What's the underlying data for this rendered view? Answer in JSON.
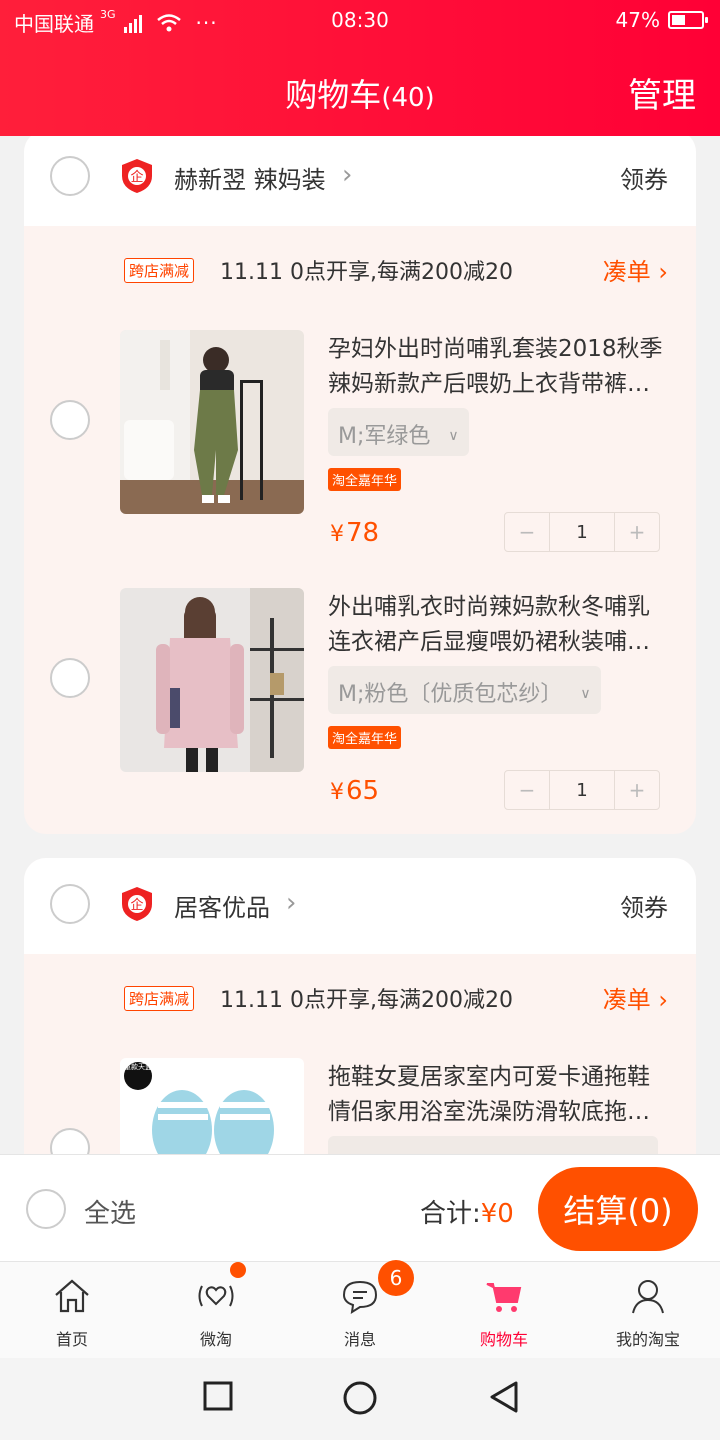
{
  "status_bar": {
    "carrier": "中国联通",
    "network": "3G",
    "time": "08:30",
    "battery_text": "47%",
    "battery_level": 0.47,
    "more_dots": "···"
  },
  "header": {
    "title": "购物车",
    "count": "(40)",
    "manage_label": "管理"
  },
  "stores": [
    {
      "name": "赫新翌 辣妈装",
      "coupon_label": "领券",
      "promo": {
        "tag": "跨店满减",
        "text": "11.11 0点开享,每满200减20",
        "link": "凑单"
      },
      "items": [
        {
          "title": "孕妇外出时尚哺乳套装2018秋季辣妈新款产后喂奶上衣背带裤…",
          "sku": "M;军绿色",
          "activity": "淘全嘉年华",
          "currency": "¥",
          "price": "78",
          "qty": "1"
        },
        {
          "title": "外出哺乳衣时尚辣妈款秋冬哺乳连衣裙产后显瘦喂奶裙秋装哺…",
          "sku": "M;粉色〔优质包芯纱〕",
          "activity": "淘全嘉年华",
          "currency": "¥",
          "price": "65",
          "qty": "1"
        }
      ]
    },
    {
      "name": "居客优品",
      "coupon_label": "领券",
      "promo": {
        "tag": "跨店满减",
        "text": "11.11 0点开享,每满200减20",
        "link": "凑单"
      },
      "items": [
        {
          "title": "拖鞋女夏居家室内可爱卡通拖鞋情侣家用浴室洗澡防滑软底拖…",
          "image_badge": "童款天蓝"
        }
      ]
    }
  ],
  "action_bar": {
    "select_all_label": "全选",
    "total_label": "合计:",
    "total_value": "¥0",
    "checkout_label": "结算(0)"
  },
  "tabs": [
    {
      "label": "首页",
      "icon": "home-icon"
    },
    {
      "label": "微淘",
      "icon": "weitao-icon"
    },
    {
      "label": "消息",
      "icon": "message-icon",
      "badge": "6"
    },
    {
      "label": "购物车",
      "icon": "cart-icon",
      "active": true
    },
    {
      "label": "我的淘宝",
      "icon": "profile-icon"
    }
  ],
  "colors": {
    "header": "#ff0036",
    "accent": "#ff5000",
    "card_bg": "#fdf3f0"
  }
}
